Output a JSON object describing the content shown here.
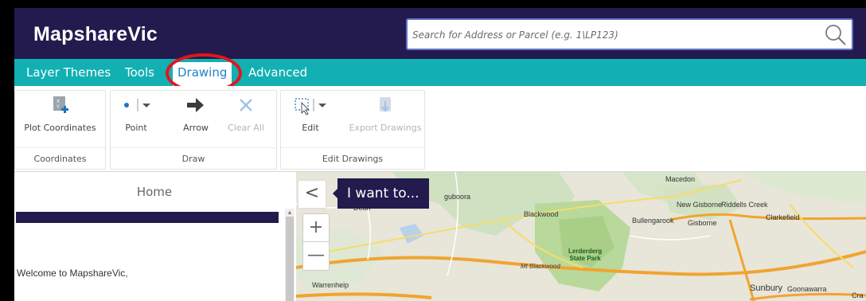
{
  "header": {
    "app_title": "MapshareVic",
    "search_placeholder": "Search for Address or Parcel (e.g. 1\\LP123)"
  },
  "tabs": [
    {
      "label": "Layer Themes",
      "active": false
    },
    {
      "label": "Tools",
      "active": false
    },
    {
      "label": "Drawing",
      "active": true
    },
    {
      "label": "Advanced",
      "active": false
    }
  ],
  "ribbon": {
    "groups": [
      {
        "label": "Coordinates",
        "buttons": [
          {
            "label": "Plot Coordinates",
            "icon": "plot-coordinates-icon"
          }
        ]
      },
      {
        "label": "Draw",
        "buttons": [
          {
            "label": "Point",
            "icon": "point-icon",
            "enabled": true
          },
          {
            "label": "Arrow",
            "icon": "arrow-icon",
            "enabled": true
          },
          {
            "label": "Clear All",
            "icon": "clear-icon",
            "enabled": false
          }
        ]
      },
      {
        "label": "Edit Drawings",
        "buttons": [
          {
            "label": "Edit",
            "icon": "edit-selection-icon",
            "enabled": true
          },
          {
            "label": "Export Drawings",
            "icon": "export-icon",
            "enabled": false
          }
        ]
      }
    ]
  },
  "left_panel": {
    "title": "Home",
    "welcome": "Welcome to MapshareVic,"
  },
  "map": {
    "collapse_symbol": "<",
    "i_want_to": "I want to...",
    "zoom_in": "+",
    "zoom_out": "—",
    "places": [
      "Macedon",
      "New Gisborne",
      "Riddells Creek",
      "Bullengarook",
      "Gisborne",
      "Clarkefield",
      "Blackwood",
      "Dean",
      "Warrenheip",
      "Sunbury",
      "Goonawarra",
      "guboora",
      "Cra"
    ],
    "park": [
      "Lerderderg",
      "State Park"
    ],
    "road_label": "Mt Blackwood"
  },
  "colors": {
    "header_bg": "#231a4e",
    "tab_bar": "#12b0b3",
    "active_tab_text": "#1f82c9",
    "annotation_ring": "#e3141b"
  }
}
